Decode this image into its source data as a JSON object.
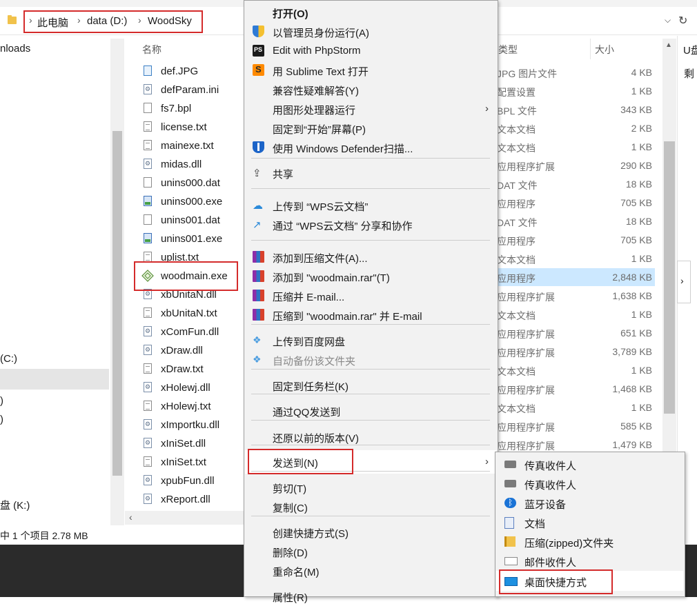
{
  "address": {
    "crumbs": [
      "此电脑",
      "data (D:)",
      "WoodSky"
    ],
    "dropdown_icon": "chevron-down",
    "refresh_icon": "refresh"
  },
  "nav_pane": {
    "items": [
      "nloads",
      "(C:)",
      ")",
      ")",
      "盘 (K:)"
    ]
  },
  "columns": {
    "name": "名称",
    "type": "类型",
    "size": "大小"
  },
  "files": [
    {
      "name": "def.JPG",
      "icon": "jpg",
      "type": "JPG 图片文件",
      "size": "4 KB"
    },
    {
      "name": "defParam.ini",
      "icon": "dll",
      "type": "配置设置",
      "size": "1 KB"
    },
    {
      "name": "fs7.bpl",
      "icon": "file",
      "type": "BPL 文件",
      "size": "343 KB"
    },
    {
      "name": "license.txt",
      "icon": "txt",
      "type": "文本文档",
      "size": "2 KB"
    },
    {
      "name": "mainexe.txt",
      "icon": "txt",
      "type": "文本文档",
      "size": "1 KB"
    },
    {
      "name": "midas.dll",
      "icon": "dll",
      "type": "应用程序扩展",
      "size": "290 KB"
    },
    {
      "name": "unins000.dat",
      "icon": "file",
      "type": "DAT 文件",
      "size": "18 KB"
    },
    {
      "name": "unins000.exe",
      "icon": "exe",
      "type": "应用程序",
      "size": "705 KB"
    },
    {
      "name": "unins001.dat",
      "icon": "file",
      "type": "DAT 文件",
      "size": "18 KB"
    },
    {
      "name": "unins001.exe",
      "icon": "exe",
      "type": "应用程序",
      "size": "705 KB"
    },
    {
      "name": "uplist.txt",
      "icon": "txt",
      "type": "文本文档",
      "size": "1 KB"
    },
    {
      "name": "woodmain.exe",
      "icon": "wood",
      "type": "应用程序",
      "size": "2,848 KB"
    },
    {
      "name": "xbUnitaN.dll",
      "icon": "dll",
      "type": "应用程序扩展",
      "size": "1,638 KB"
    },
    {
      "name": "xbUnitaN.txt",
      "icon": "txt",
      "type": "文本文档",
      "size": "1 KB"
    },
    {
      "name": "xComFun.dll",
      "icon": "dll",
      "type": "应用程序扩展",
      "size": "651 KB"
    },
    {
      "name": "xDraw.dll",
      "icon": "dll",
      "type": "应用程序扩展",
      "size": "3,789 KB"
    },
    {
      "name": "xDraw.txt",
      "icon": "txt",
      "type": "文本文档",
      "size": "1 KB"
    },
    {
      "name": "xHolewj.dll",
      "icon": "dll",
      "type": "应用程序扩展",
      "size": "1,468 KB"
    },
    {
      "name": "xHolewj.txt",
      "icon": "txt",
      "type": "文本文档",
      "size": "1 KB"
    },
    {
      "name": "xImportku.dll",
      "icon": "dll",
      "type": "应用程序扩展",
      "size": "585 KB"
    },
    {
      "name": "xIniSet.dll",
      "icon": "dll",
      "type": "应用程序扩展",
      "size": "1,479 KB"
    },
    {
      "name": "xIniSet.txt",
      "icon": "txt",
      "type": "",
      "size": ""
    },
    {
      "name": "xpubFun.dll",
      "icon": "dll",
      "type": "",
      "size": ""
    },
    {
      "name": "xReport.dll",
      "icon": "dll",
      "type": "",
      "size": ""
    }
  ],
  "right_panel": {
    "title": "U盘",
    "line": "剩"
  },
  "status": {
    "text": "中 1 个项目  2.78 MB"
  },
  "context_menu": {
    "items": [
      {
        "label": "打开(O)",
        "icon": "none",
        "bold": true
      },
      {
        "label": "以管理员身份运行(A)",
        "icon": "uac-shield-icon"
      },
      {
        "label": "Edit with PhpStorm",
        "icon": "phpstorm-icon"
      },
      {
        "label": "用 Sublime Text 打开",
        "icon": "sublime-icon"
      },
      {
        "label": "兼容性疑难解答(Y)",
        "icon": "none"
      },
      {
        "label": "用图形处理器运行",
        "icon": "none",
        "submenu": true
      },
      {
        "label": "固定到“开始”屏幕(P)",
        "icon": "none"
      },
      {
        "label": "使用 Windows Defender扫描...",
        "icon": "defender-icon"
      },
      {
        "label": "共享",
        "icon": "share-icon"
      },
      {
        "label": "上传到 “WPS云文档”",
        "icon": "wps-upload-icon"
      },
      {
        "label": "通过 “WPS云文档” 分享和协作",
        "icon": "wps-share-icon"
      },
      {
        "label": "添加到压缩文件(A)...",
        "icon": "winrar-icon"
      },
      {
        "label": "添加到 \"woodmain.rar\"(T)",
        "icon": "winrar-icon"
      },
      {
        "label": "压缩并 E-mail...",
        "icon": "winrar-icon"
      },
      {
        "label": "压缩到 \"woodmain.rar\" 并 E-mail",
        "icon": "winrar-icon"
      },
      {
        "label": "上传到百度网盘",
        "icon": "baidu-icon"
      },
      {
        "label": "自动备份该文件夹",
        "icon": "baidu-icon",
        "disabled": true
      },
      {
        "label": "固定到任务栏(K)",
        "icon": "none"
      },
      {
        "label": "通过QQ发送到",
        "icon": "none"
      },
      {
        "label": "还原以前的版本(V)",
        "icon": "none"
      },
      {
        "label": "发送到(N)",
        "icon": "none",
        "submenu": true
      },
      {
        "label": "剪切(T)",
        "icon": "none"
      },
      {
        "label": "复制(C)",
        "icon": "none"
      },
      {
        "label": "创建快捷方式(S)",
        "icon": "none"
      },
      {
        "label": "删除(D)",
        "icon": "none"
      },
      {
        "label": "重命名(M)",
        "icon": "none"
      },
      {
        "label": "属性(R)",
        "icon": "none"
      }
    ]
  },
  "send_to_menu": {
    "items": [
      {
        "label": "传真收件人",
        "icon": "fax-icon"
      },
      {
        "label": "传真收件人",
        "icon": "fax-icon"
      },
      {
        "label": "蓝牙设备",
        "icon": "bluetooth-icon"
      },
      {
        "label": "文档",
        "icon": "documents-icon"
      },
      {
        "label": "压缩(zipped)文件夹",
        "icon": "zip-folder-icon"
      },
      {
        "label": "邮件收件人",
        "icon": "mail-icon"
      },
      {
        "label": "桌面快捷方式",
        "icon": "desktop-icon"
      }
    ]
  },
  "colors": {
    "selection": "#cce8ff",
    "annotation_red": "#d42a2a",
    "menu_bg": "#f2f2f2"
  }
}
